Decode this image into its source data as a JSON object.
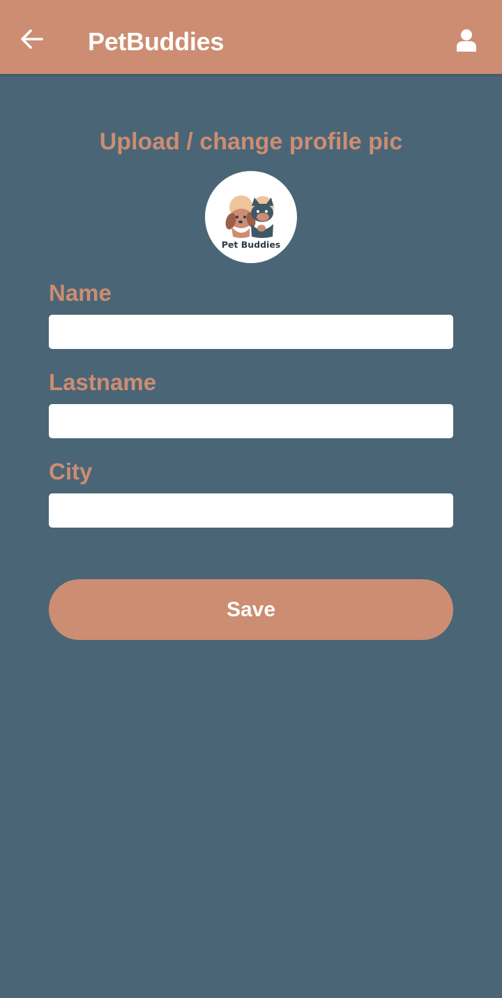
{
  "header": {
    "title": "PetBuddies",
    "back_icon": "arrow-left-icon",
    "profile_icon": "user-icon"
  },
  "upload": {
    "heading": "Upload / change profile pic",
    "logo_text": "Pet Buddies"
  },
  "form": {
    "name_label": "Name",
    "name_value": "",
    "lastname_label": "Lastname",
    "lastname_value": "",
    "city_label": "City",
    "city_value": "",
    "save_label": "Save"
  },
  "colors": {
    "accent": "#cc8d72",
    "background": "#4a6676",
    "input_bg": "#ffffff",
    "text_on_accent": "#ffffff"
  }
}
